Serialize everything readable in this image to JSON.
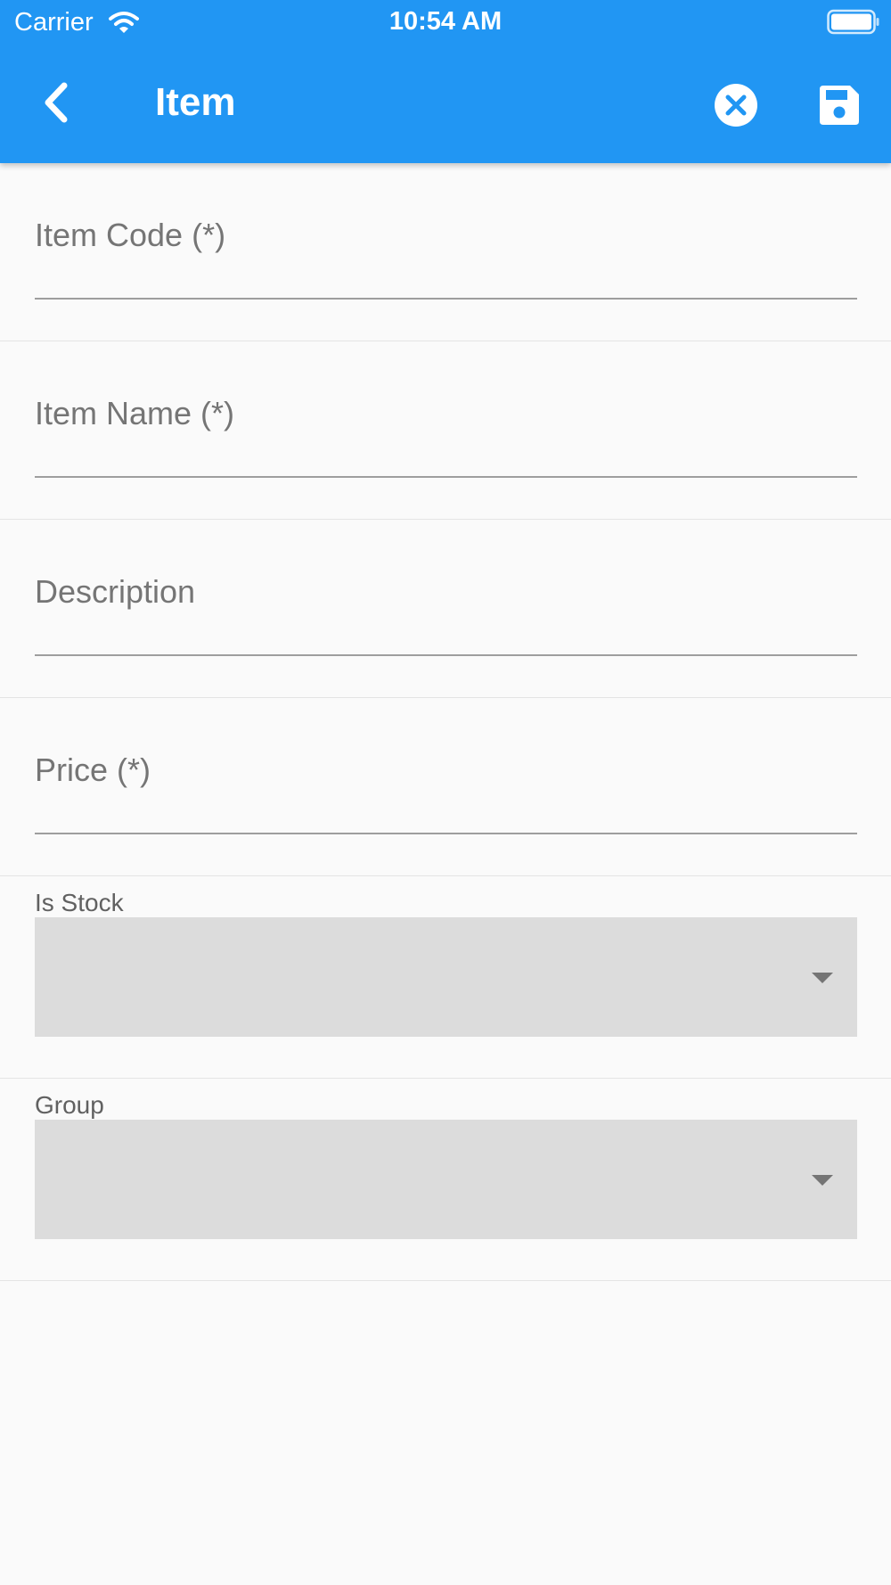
{
  "status_bar": {
    "carrier": "Carrier",
    "time": "10:54 AM"
  },
  "app_bar": {
    "title": "Item",
    "back_icon": "chevron-left-icon",
    "cancel_icon": "close-circle-icon",
    "save_icon": "floppy-disk-icon"
  },
  "form": {
    "item_code": {
      "label": "Item Code (*)",
      "value": ""
    },
    "item_name": {
      "label": "Item Name (*)",
      "value": ""
    },
    "description": {
      "label": "Description",
      "value": ""
    },
    "price": {
      "label": "Price (*)",
      "value": ""
    },
    "is_stock": {
      "label": "Is Stock",
      "selected": ""
    },
    "group": {
      "label": "Group",
      "selected": ""
    }
  },
  "colors": {
    "primary": "#2196f3",
    "background": "#fafafa",
    "label": "#757575",
    "dropdown_fill": "#dcdcdc"
  }
}
